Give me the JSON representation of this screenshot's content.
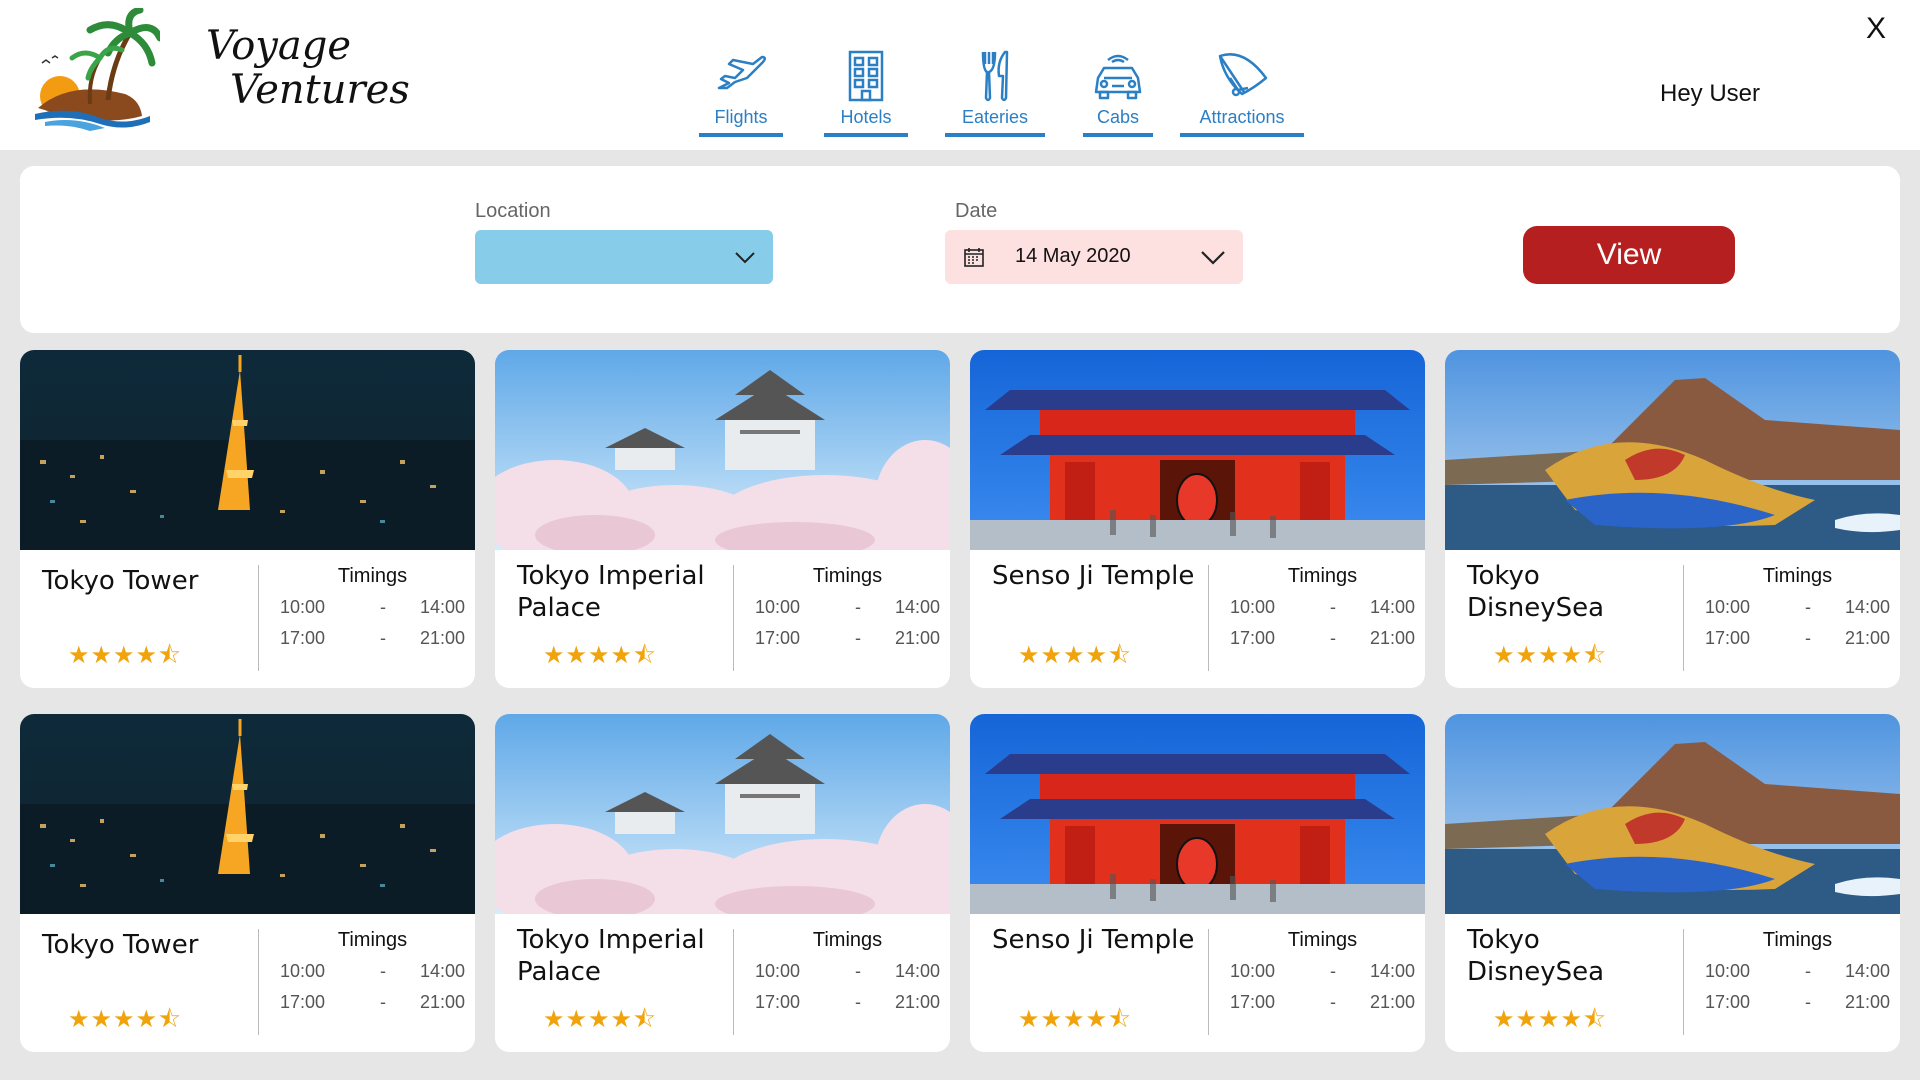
{
  "app": {
    "brand_line1": "Voyage",
    "brand_line2": "Ventures",
    "greeting": "Hey User",
    "close_label": "X"
  },
  "nav": [
    {
      "label": "Flights",
      "icon": "airplane-icon"
    },
    {
      "label": "Hotels",
      "icon": "building-icon"
    },
    {
      "label": "Eateries",
      "icon": "fork-knife-icon"
    },
    {
      "label": "Cabs",
      "icon": "car-icon"
    },
    {
      "label": "Attractions",
      "icon": "hang-glider-icon"
    }
  ],
  "filter": {
    "location_label": "Location",
    "location_value": "",
    "date_label": "Date",
    "date_value": "14 May 2020",
    "view_label": "View"
  },
  "colors": {
    "accent": "#2b7fc4",
    "button": "#b51f1f",
    "location_bg": "#87cde9",
    "date_bg": "#fde0e0",
    "star": "#f0a30a"
  },
  "cards": [
    {
      "title": "Tokyo Tower",
      "rating": 4.5,
      "stars": "★★★★⯪",
      "timings_label": "Timings",
      "slots": [
        [
          "10:00",
          "-",
          "14:00"
        ],
        [
          "17:00",
          "-",
          "21:00"
        ]
      ],
      "image": "tokyo-tower-night"
    },
    {
      "title": "Tokyo Imperial Palace",
      "rating": 4.5,
      "stars": "★★★★⯪",
      "timings_label": "Timings",
      "slots": [
        [
          "10:00",
          "-",
          "14:00"
        ],
        [
          "17:00",
          "-",
          "21:00"
        ]
      ],
      "image": "castle-cherry-blossom"
    },
    {
      "title": "Senso Ji Temple",
      "rating": 4.5,
      "stars": "★★★★⯪",
      "timings_label": "Timings",
      "slots": [
        [
          "10:00",
          "-",
          "14:00"
        ],
        [
          "17:00",
          "-",
          "21:00"
        ]
      ],
      "image": "red-temple-gate"
    },
    {
      "title": "Tokyo DisneySea",
      "rating": 4.5,
      "stars": "★★★★⯪",
      "timings_label": "Timings",
      "slots": [
        [
          "10:00",
          "-",
          "14:00"
        ],
        [
          "17:00",
          "-",
          "21:00"
        ]
      ],
      "image": "disneysea-volcano-boat"
    },
    {
      "title": "Tokyo Tower",
      "rating": 4.5,
      "stars": "★★★★⯪",
      "timings_label": "Timings",
      "slots": [
        [
          "10:00",
          "-",
          "14:00"
        ],
        [
          "17:00",
          "-",
          "21:00"
        ]
      ],
      "image": "tokyo-tower-night"
    },
    {
      "title": "Tokyo Imperial Palace",
      "rating": 4.5,
      "stars": "★★★★⯪",
      "timings_label": "Timings",
      "slots": [
        [
          "10:00",
          "-",
          "14:00"
        ],
        [
          "17:00",
          "-",
          "21:00"
        ]
      ],
      "image": "castle-cherry-blossom"
    },
    {
      "title": "Senso Ji Temple",
      "rating": 4.5,
      "stars": "★★★★⯪",
      "timings_label": "Timings",
      "slots": [
        [
          "10:00",
          "-",
          "14:00"
        ],
        [
          "17:00",
          "-",
          "21:00"
        ]
      ],
      "image": "red-temple-gate"
    },
    {
      "title": "Tokyo DisneySea",
      "rating": 4.5,
      "stars": "★★★★⯪",
      "timings_label": "Timings",
      "slots": [
        [
          "10:00",
          "-",
          "14:00"
        ],
        [
          "17:00",
          "-",
          "21:00"
        ]
      ],
      "image": "disneysea-volcano-boat"
    }
  ]
}
